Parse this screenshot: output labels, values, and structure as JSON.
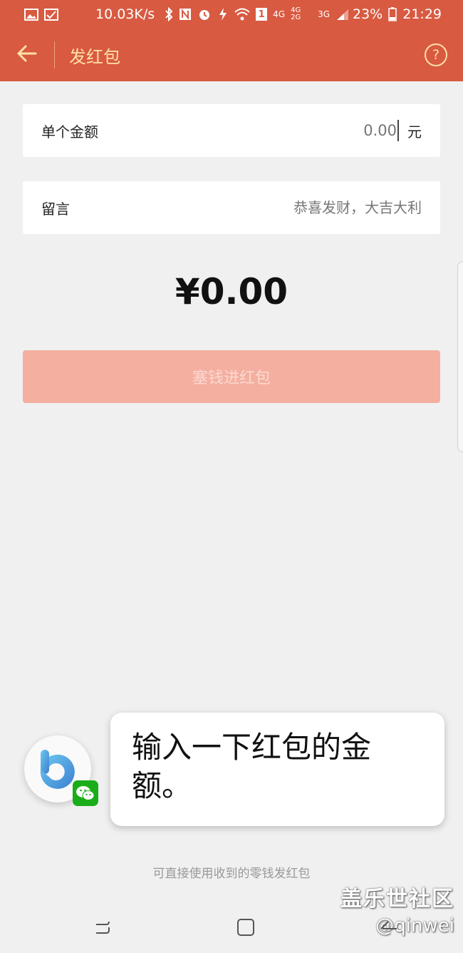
{
  "status_bar": {
    "network_rate": "10.03K/s",
    "network_4g": "4G",
    "network_4g2g": "4G 2G",
    "network_3g": "3G",
    "sim_badge": "1",
    "battery": "23%",
    "time": "21:29"
  },
  "header": {
    "title": "发红包",
    "back_icon": "back-arrow-icon",
    "help_icon": "help-circle-icon",
    "help_glyph": "?"
  },
  "form": {
    "amount_label": "单个金额",
    "amount_placeholder": "0.00",
    "amount_unit": "元",
    "message_label": "留言",
    "message_placeholder": "恭喜发财，大吉大利"
  },
  "total": "¥0.00",
  "submit_label": "塞钱进红包",
  "assistant": {
    "message": "输入一下红包的金额。",
    "avatar_icon": "bixby-icon",
    "badge_icon": "wechat-icon"
  },
  "footer_hint": "可直接使用收到的零钱发红包",
  "watermark": {
    "title": "盖乐世社区",
    "user": "@qinwei"
  },
  "colors": {
    "header_bg": "#d85a41",
    "header_text": "#ffe0a8",
    "button_disabled": "#f4afa0",
    "wechat_green": "#1aad19"
  }
}
